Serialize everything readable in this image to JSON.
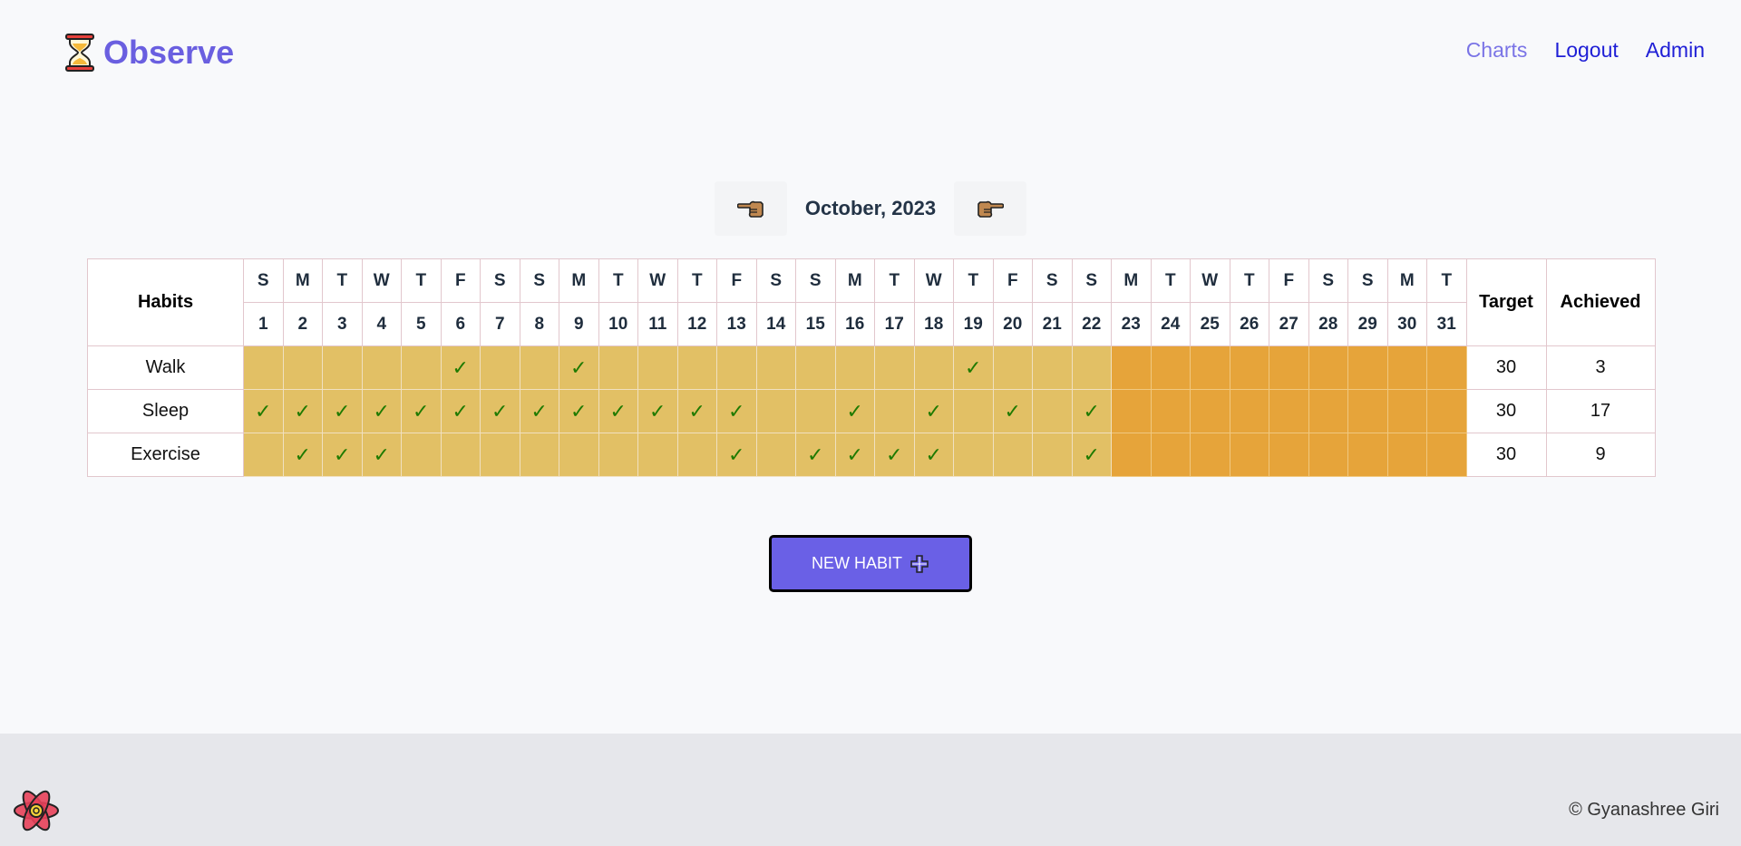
{
  "brand": {
    "title": "Observe",
    "icon": "hourglass-icon"
  },
  "nav": {
    "charts": "Charts",
    "logout": "Logout",
    "admin": "Admin"
  },
  "month": {
    "label": "October, 2023",
    "prev_icon": "pointing-left-icon",
    "next_icon": "pointing-right-icon"
  },
  "table": {
    "habits_header": "Habits",
    "target_header": "Target",
    "achieved_header": "Achieved",
    "weekdays": [
      "S",
      "M",
      "T",
      "W",
      "T",
      "F",
      "S",
      "S",
      "M",
      "T",
      "W",
      "T",
      "F",
      "S",
      "S",
      "M",
      "T",
      "W",
      "T",
      "F",
      "S",
      "S",
      "M",
      "T",
      "W",
      "T",
      "F",
      "S",
      "S",
      "M",
      "T"
    ],
    "days": [
      "1",
      "2",
      "3",
      "4",
      "5",
      "6",
      "7",
      "8",
      "9",
      "10",
      "11",
      "12",
      "13",
      "14",
      "15",
      "16",
      "17",
      "18",
      "19",
      "20",
      "21",
      "22",
      "23",
      "24",
      "25",
      "26",
      "27",
      "28",
      "29",
      "30",
      "31"
    ],
    "last_past_day": 22,
    "check_symbol": "✓",
    "rows": [
      {
        "name": "Walk",
        "checked": [
          6,
          9,
          19
        ],
        "target": "30",
        "achieved": "3"
      },
      {
        "name": "Sleep",
        "checked": [
          1,
          2,
          3,
          4,
          5,
          6,
          7,
          8,
          9,
          10,
          11,
          12,
          13,
          16,
          18,
          20,
          22
        ],
        "target": "30",
        "achieved": "17"
      },
      {
        "name": "Exercise",
        "checked": [
          2,
          3,
          4,
          13,
          15,
          16,
          17,
          18,
          22
        ],
        "target": "30",
        "achieved": "9"
      }
    ]
  },
  "new_habit": {
    "label": "NEW HABIT",
    "icon": "plus-icon"
  },
  "colors": {
    "brand": "#6a5fe0",
    "past_cell": "#e2c065",
    "future_cell": "#e6a43a",
    "check": "#1f7a00",
    "button": "#6a60e6"
  },
  "footer": {
    "logo_icon": "react-logo-icon",
    "copyright": "© Gyanashree Giri"
  }
}
